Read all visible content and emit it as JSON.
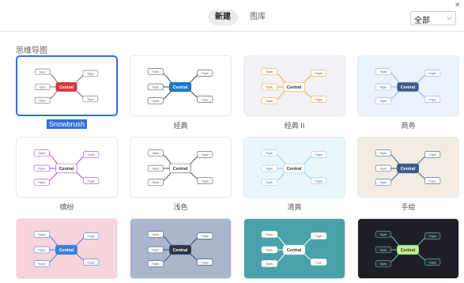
{
  "header": {
    "tabs": [
      {
        "label": "新建",
        "active": true
      },
      {
        "label": "图库",
        "active": false
      }
    ],
    "filter": {
      "selected": "全部"
    }
  },
  "section": {
    "title": "思维导图"
  },
  "themes": [
    {
      "name": "Snowbrush",
      "selected": true,
      "bg": "#ffffff",
      "central": "#e8333a",
      "centralText": "Central",
      "line": "#666666"
    },
    {
      "name": "经典",
      "selected": false,
      "bg": "#ffffff",
      "central": "#1a7bd6",
      "centralText": "Central",
      "line": "#444444"
    },
    {
      "name": "经典 II",
      "selected": false,
      "bg": "#f2f2f6",
      "central": "#ffffff",
      "centralText": "Central",
      "line": "#f0a830"
    },
    {
      "name": "商务",
      "selected": false,
      "bg": "#eaf2fb",
      "central": "#3c5a8c",
      "centralText": "Central",
      "line": "#8cb0d8"
    },
    {
      "name": "缤纷",
      "selected": false,
      "bg": "#ffffff",
      "central": "#ffffff",
      "centralText": "Central",
      "line": "#a04bc8"
    },
    {
      "name": "浅色",
      "selected": false,
      "bg": "#ffffff",
      "central": "#ffffff",
      "centralText": "Central",
      "line": "#555555"
    },
    {
      "name": "清爽",
      "selected": false,
      "bg": "#eaf6fb",
      "central": "#ffffff",
      "centralText": "Central",
      "line": "#8ecbe5"
    },
    {
      "name": "手绘",
      "selected": false,
      "bg": "#f3ece4",
      "central": "#3d5c86",
      "centralText": "Central",
      "line": "#3d5c86"
    },
    {
      "name": "",
      "selected": false,
      "bg": "#f7d3dc",
      "central": "#3b7fd9",
      "centralText": "Central",
      "line": "#3b7fd9"
    },
    {
      "name": "",
      "selected": false,
      "bg": "#aab6cc",
      "central": "#2e3440",
      "centralText": "Central",
      "line": "#2e4a7c"
    },
    {
      "name": "",
      "selected": false,
      "bg": "#49a2ab",
      "central": "#ffffff",
      "centralText": "Central",
      "line": "#ffffff"
    },
    {
      "name": "",
      "selected": false,
      "bg": "#1e1e26",
      "central": "#c6ec8a",
      "centralText": "Central",
      "line": "#5ed3a8"
    }
  ],
  "topic": "Topic"
}
